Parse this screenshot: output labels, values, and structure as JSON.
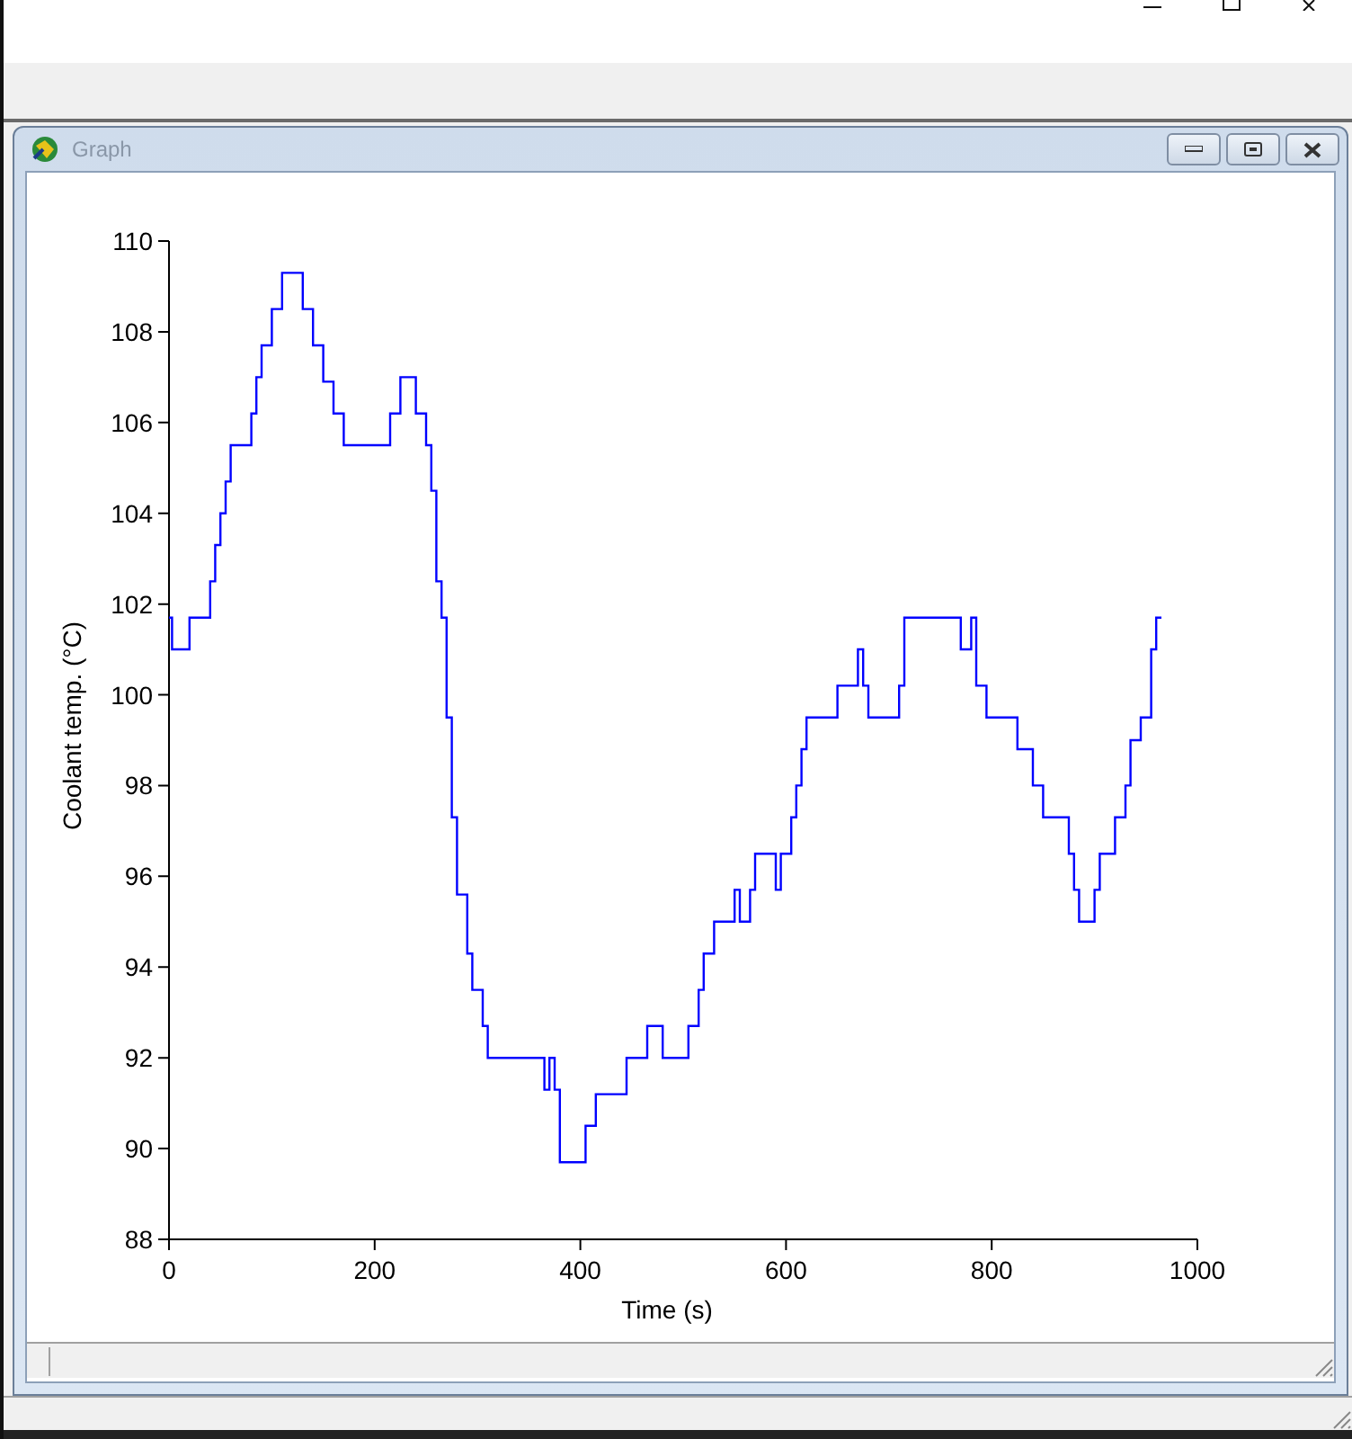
{
  "graph_window": {
    "title": "Graph",
    "chart_data": {
      "type": "line",
      "xlabel": "Time (s)",
      "ylabel": "Coolant temp. (°C)",
      "xlim": [
        0,
        1000
      ],
      "ylim": [
        88,
        110
      ],
      "xticks": [
        0,
        200,
        400,
        600,
        800,
        1000
      ],
      "yticks": [
        88,
        90,
        92,
        94,
        96,
        98,
        100,
        102,
        104,
        106,
        108,
        110
      ],
      "x": [
        0,
        3,
        3,
        20,
        20,
        40,
        40,
        45,
        45,
        50,
        50,
        55,
        55,
        60,
        60,
        80,
        80,
        85,
        85,
        90,
        90,
        100,
        100,
        110,
        110,
        130,
        130,
        140,
        140,
        150,
        150,
        160,
        160,
        170,
        170,
        215,
        215,
        225,
        225,
        240,
        240,
        250,
        250,
        255,
        255,
        260,
        260,
        265,
        265,
        270,
        270,
        275,
        275,
        280,
        280,
        290,
        290,
        295,
        295,
        305,
        305,
        310,
        310,
        365,
        365,
        370,
        370,
        375,
        375,
        380,
        380,
        405,
        405,
        415,
        415,
        445,
        445,
        465,
        465,
        480,
        480,
        505,
        505,
        515,
        515,
        520,
        520,
        530,
        530,
        550,
        550,
        555,
        555,
        565,
        565,
        570,
        570,
        590,
        590,
        595,
        595,
        605,
        605,
        610,
        610,
        615,
        615,
        620,
        620,
        650,
        650,
        670,
        670,
        675,
        675,
        680,
        680,
        710,
        710,
        715,
        715,
        770,
        770,
        780,
        780,
        785,
        785,
        795,
        795,
        825,
        825,
        840,
        840,
        850,
        850,
        875,
        875,
        880,
        880,
        885,
        885,
        900,
        900,
        905,
        905,
        920,
        920,
        930,
        930,
        935,
        935,
        945,
        945,
        955,
        955,
        960,
        960,
        965
      ],
      "series": [
        {
          "color": "#0000ff",
          "values": [
            101.7,
            101.7,
            101,
            101,
            101.7,
            101.7,
            102.5,
            102.5,
            103.3,
            103.3,
            104,
            104,
            104.7,
            104.7,
            105.5,
            105.5,
            106.2,
            106.2,
            107,
            107,
            107.7,
            107.7,
            108.5,
            108.5,
            109.3,
            109.3,
            108.5,
            108.5,
            107.7,
            107.7,
            106.9,
            106.9,
            106.2,
            106.2,
            105.5,
            105.5,
            106.2,
            106.2,
            107,
            107,
            106.2,
            106.2,
            105.5,
            105.5,
            104.5,
            104.5,
            102.5,
            102.5,
            101.7,
            101.7,
            99.5,
            99.5,
            97.3,
            97.3,
            95.6,
            95.6,
            94.3,
            94.3,
            93.5,
            93.5,
            92.7,
            92.7,
            92,
            92,
            91.3,
            91.3,
            92,
            92,
            91.3,
            91.3,
            89.7,
            89.7,
            90.5,
            90.5,
            91.2,
            91.2,
            92,
            92,
            92.7,
            92.7,
            92,
            92,
            92.7,
            92.7,
            93.5,
            93.5,
            94.3,
            94.3,
            95,
            95,
            95.7,
            95.7,
            95,
            95,
            95.7,
            95.7,
            96.5,
            96.5,
            95.7,
            95.7,
            96.5,
            96.5,
            97.3,
            97.3,
            98,
            98,
            98.8,
            98.8,
            99.5,
            99.5,
            100.2,
            100.2,
            101,
            101,
            100.2,
            100.2,
            99.5,
            99.5,
            100.2,
            100.2,
            101.7,
            101.7,
            101,
            101,
            101.7,
            101.7,
            100.2,
            100.2,
            99.5,
            99.5,
            98.8,
            98.8,
            98,
            98,
            97.3,
            97.3,
            96.5,
            96.5,
            95.7,
            95.7,
            95,
            95,
            95.7,
            95.7,
            96.5,
            96.5,
            97.3,
            97.3,
            98,
            98,
            99,
            99,
            99.5,
            99.5,
            101,
            101,
            101.7,
            101.7
          ]
        }
      ]
    }
  }
}
